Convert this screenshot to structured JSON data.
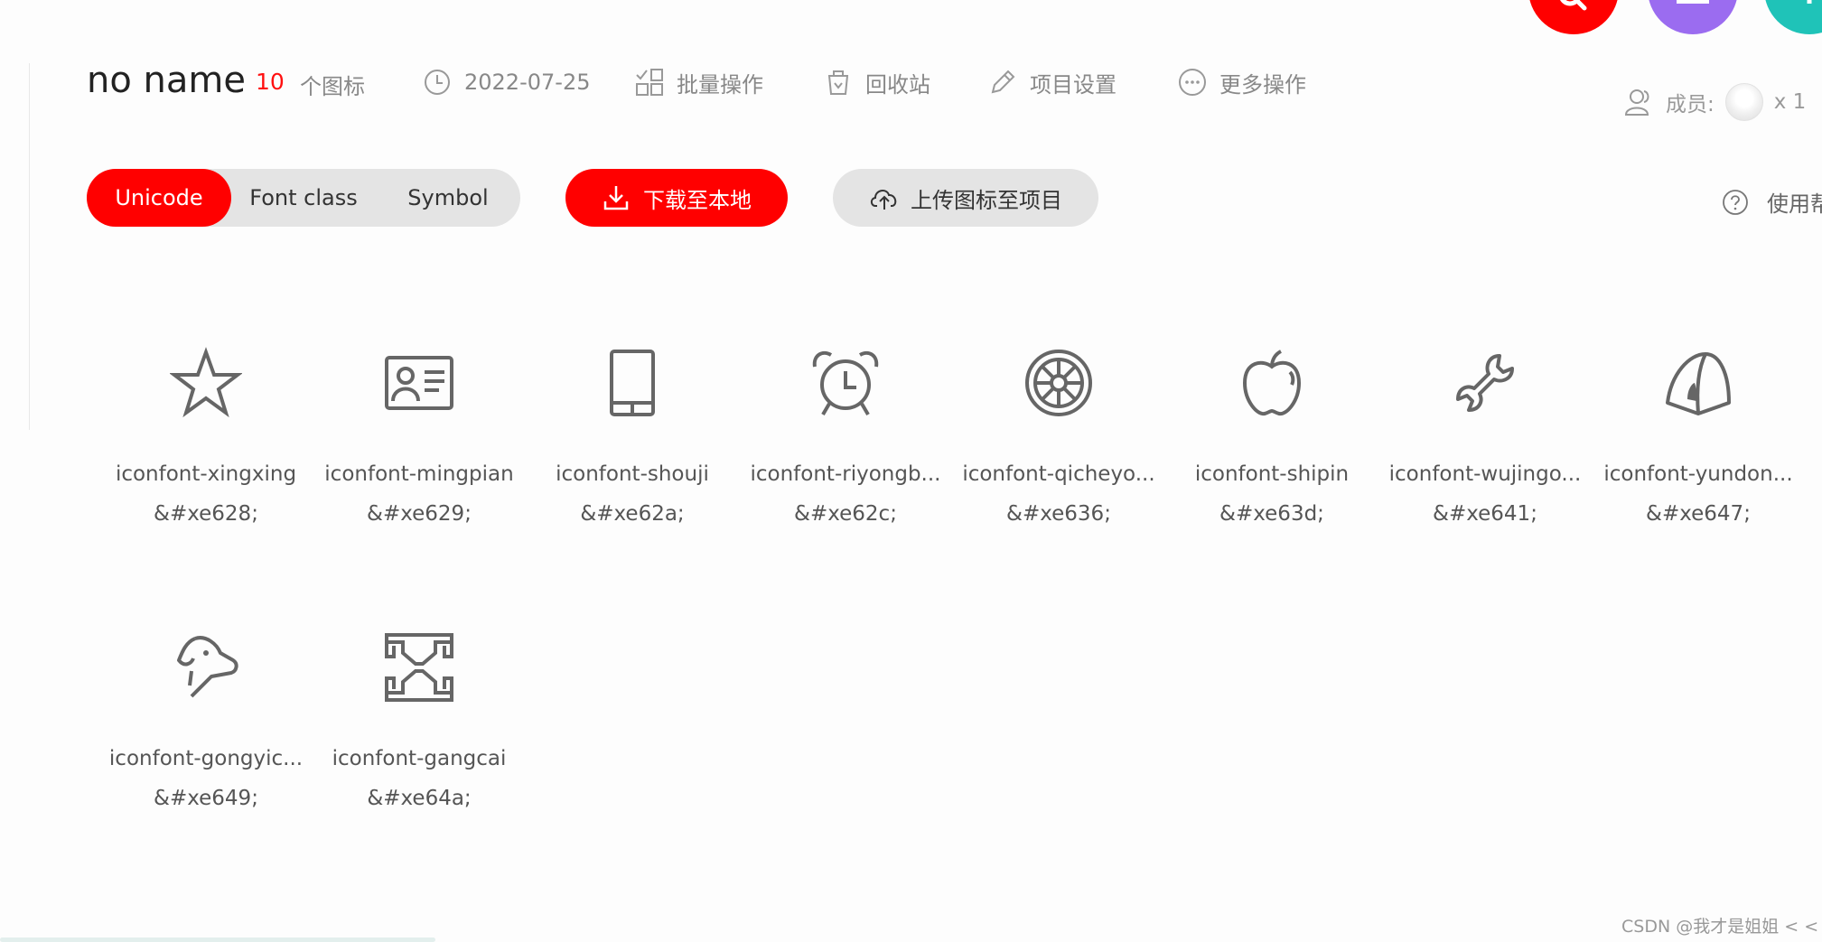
{
  "header": {
    "title": "no name",
    "icon_count": "10",
    "icon_count_label": "个图标",
    "date": "2022-07-25",
    "batch_label": "批量操作",
    "recycle_label": "回收站",
    "settings_label": "项目设置",
    "more_label": "更多操作",
    "members_label": "成员:",
    "members_count": "x 1"
  },
  "toolbar": {
    "tabs": [
      "Unicode",
      "Font class",
      "Symbol"
    ],
    "active_tab": "Unicode",
    "download_label": "下载至本地",
    "upload_label": "上传图标至项目",
    "help_label": "使用帮"
  },
  "icons": [
    {
      "name": "iconfont-xingxing",
      "code": "&#xe628;",
      "icon": "star-icon"
    },
    {
      "name": "iconfont-mingpian",
      "code": "&#xe629;",
      "icon": "business-card-icon"
    },
    {
      "name": "iconfont-shouji",
      "code": "&#xe62a;",
      "icon": "phone-icon"
    },
    {
      "name": "iconfont-riyongb...",
      "code": "&#xe62c;",
      "icon": "alarm-clock-icon"
    },
    {
      "name": "iconfont-qicheyo...",
      "code": "&#xe636;",
      "icon": "wheel-icon"
    },
    {
      "name": "iconfont-shipin",
      "code": "&#xe63d;",
      "icon": "apple-icon"
    },
    {
      "name": "iconfont-wujingo...",
      "code": "&#xe641;",
      "icon": "wrench-icon"
    },
    {
      "name": "iconfont-yundon...",
      "code": "&#xe647;",
      "icon": "tent-icon"
    },
    {
      "name": "iconfont-gongyic...",
      "code": "&#xe649;",
      "icon": "dog-icon"
    },
    {
      "name": "iconfont-gangcai",
      "code": "&#xe64a;",
      "icon": "steel-icon"
    }
  ],
  "colors": {
    "accent": "#ff0000",
    "icon_stroke": "#666666",
    "fab_purple": "#9b6cf0",
    "fab_teal": "#1fc3b8"
  },
  "watermark": "CSDN @我才是姐姐 < <"
}
